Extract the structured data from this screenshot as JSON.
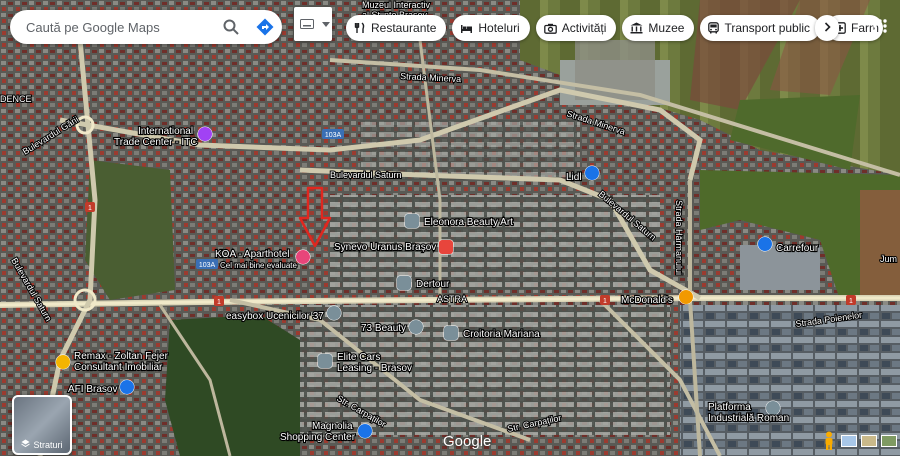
{
  "search": {
    "placeholder": "Caută pe Google Maps"
  },
  "chips": [
    {
      "label": "Restaurante",
      "icon": "fork-knife-icon"
    },
    {
      "label": "Hoteluri",
      "icon": "bed-icon"
    },
    {
      "label": "Activități",
      "icon": "camera-icon"
    },
    {
      "label": "Muzee",
      "icon": "museum-icon"
    },
    {
      "label": "Transport public",
      "icon": "bus-icon"
    },
    {
      "label": "Farm",
      "icon": "pharmacy-icon"
    }
  ],
  "layers": {
    "label": "Straturi"
  },
  "logo": "Google",
  "map": {
    "streets": {
      "strada_minerva_1": "Strada Minerva",
      "strada_minerva_2": "Strada Minerva",
      "bd_gării": "Bulevardul Gării",
      "bd_saturn_1": "Bulevardul Saturn",
      "bd_saturn_2": "Bulevardul Saturn",
      "bd_saturn_3": "Bulevardul Saturn",
      "astra": "ASTRA",
      "strada_poienelor": "Strada Poienelor",
      "str_carpatilor_1": "Str. Carpaților",
      "str_carpatilor_2": "Str. Carpaților",
      "strada_harmanului": "Strada Hărmanului",
      "road_1a": "1",
      "road_1b": "1",
      "road_1c": "1",
      "road_1d": "1",
      "road_103a_1": "103A",
      "road_103a_2": "103A"
    },
    "partial": {
      "muzeul": "Muzeul Interactiv",
      "sfinte": "al Științe Brașov",
      "dence": "DENCE",
      "jum": "Jum"
    },
    "places": {
      "itc": {
        "line1": "International",
        "line2": "Trade Center - ITC"
      },
      "eleonora": "Eleonora Beauty Art",
      "synevo": "Synevo Uranus Brașov",
      "koa": {
        "line1": "KOA - Aparthotel",
        "line2": "Cel mai bine evaluate"
      },
      "dertour": "Dertour",
      "lidl": "Lidl",
      "carrefour": "Carrefour",
      "mcdonalds": "McDonald's",
      "easybox": "easybox Ucenicilor 37",
      "beauty73": "73 Beauty",
      "croitoria": "Croitoria Mariana",
      "remax": {
        "line1": "Remax - Zoltan Fejer",
        "line2": "Consultant Imobiliar"
      },
      "afi": "AFI Brasov",
      "elite": {
        "line1": "Elite Cars",
        "line2": "Leasing - Brasov"
      },
      "magnolia": {
        "line1": "Magnolia",
        "line2": "Shopping Center"
      },
      "platforma": {
        "line1": "Platforma",
        "line2": "Industrială Roman"
      }
    }
  }
}
